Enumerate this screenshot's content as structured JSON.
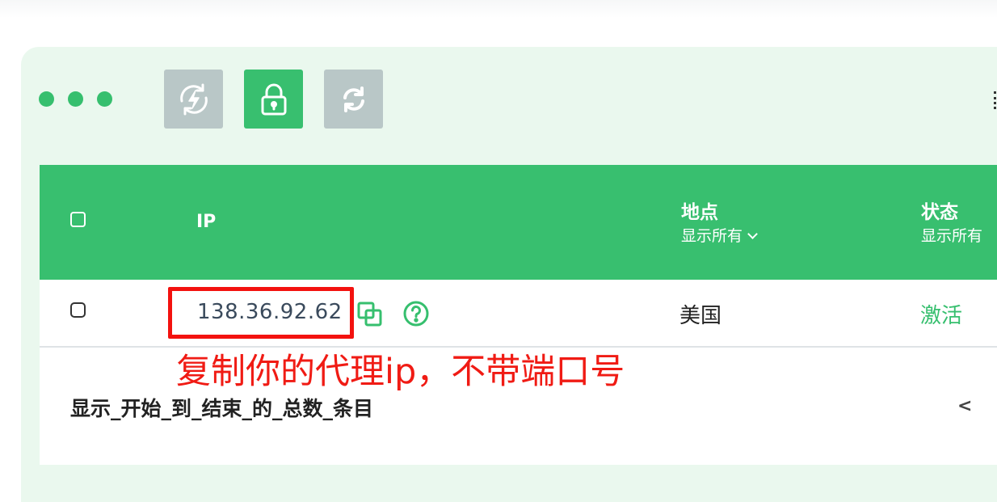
{
  "toolbar": {
    "buttons": [
      {
        "icon": "lightning-refresh-icon",
        "style": "gray"
      },
      {
        "icon": "lock-icon",
        "style": "green"
      },
      {
        "icon": "sync-icon",
        "style": "gray"
      }
    ]
  },
  "colors": {
    "accent": "#38bf6f",
    "panel_bg": "#eaf8ee",
    "gray_button": "#b9c7c7",
    "annotation_red": "#f3120f"
  },
  "table": {
    "header": {
      "ip": "IP",
      "location": {
        "label": "地点",
        "filter": "显示所有"
      },
      "status": {
        "label": "状态",
        "filter": "显示所有"
      }
    },
    "rows": [
      {
        "ip": "138.36.92.62",
        "location": "美国",
        "status": "激活"
      }
    ],
    "footer": "显示_开始_到_结束_的_总数_条目",
    "pager_prev": "<"
  },
  "annotation": {
    "text": "复制你的代理ip，不带端口号"
  }
}
